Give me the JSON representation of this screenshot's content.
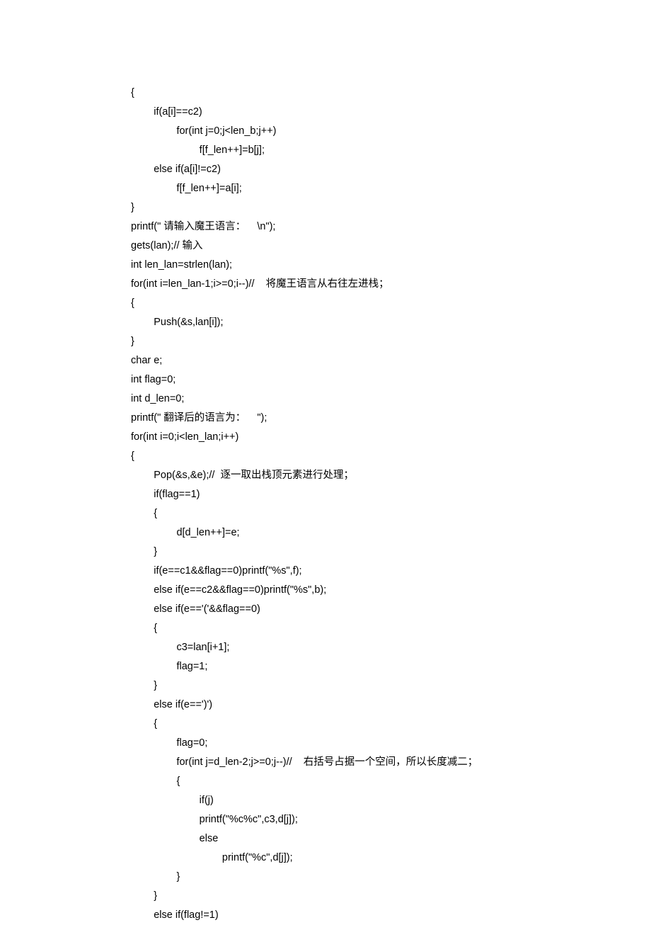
{
  "code_lines": [
    "{",
    "        if(a[i]==c2)",
    "                for(int j=0;j<len_b;j++)",
    "                        f[f_len++]=b[j];",
    "        else if(a[i]!=c2)",
    "                f[f_len++]=a[i];",
    "}",
    "printf(\" 请输入魔王语言：    \\n\");",
    "gets(lan);// 输入",
    "int len_lan=strlen(lan);",
    "for(int i=len_lan-1;i>=0;i--)//    将魔王语言从右往左进栈；",
    "{",
    "        Push(&s,lan[i]);",
    "}",
    "char e;",
    "int flag=0;",
    "int d_len=0;",
    "printf(\" 翻译后的语言为：    \");",
    "for(int i=0;i<len_lan;i++)",
    "{",
    "        Pop(&s,&e);//  逐一取出栈顶元素进行处理；",
    "        if(flag==1)",
    "        {",
    "                d[d_len++]=e;",
    "        }",
    "        if(e==c1&&flag==0)printf(\"%s\",f);",
    "        else if(e==c2&&flag==0)printf(\"%s\",b);",
    "        else if(e=='('&&flag==0)",
    "        {",
    "                c3=lan[i+1];",
    "                flag=1;",
    "        }",
    "        else if(e==')')",
    "        {",
    "                flag=0;",
    "                for(int j=d_len-2;j>=0;j--)//    右括号占据一个空间，所以长度减二；",
    "                {",
    "                        if(j)",
    "                        printf(\"%c%c\",c3,d[j]);",
    "                        else",
    "                                printf(\"%c\",d[j]);",
    "                }",
    "        }",
    "        else if(flag!=1)"
  ]
}
